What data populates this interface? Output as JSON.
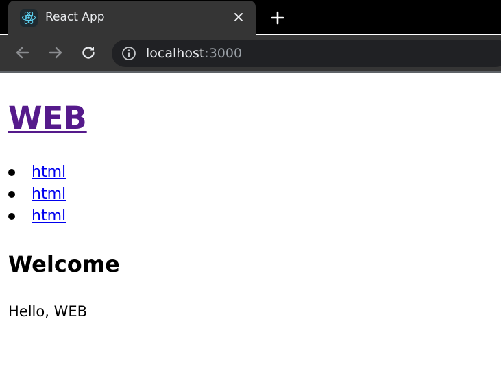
{
  "browser": {
    "tab": {
      "title": "React App",
      "favicon": "react-logo-icon",
      "close_icon": "close-icon"
    },
    "new_tab_icon": "plus-icon",
    "toolbar": {
      "back_icon": "arrow-left-icon",
      "forward_icon": "arrow-right-icon",
      "reload_icon": "reload-icon",
      "info_icon": "info-icon"
    },
    "address": {
      "host": "localhost",
      "port": ":3000"
    },
    "colors": {
      "tabstrip": "#000000",
      "toolbar": "#353535",
      "omnibox": "#202124",
      "react_accent": "#61dafb"
    }
  },
  "page": {
    "title": "WEB",
    "nav": {
      "items": [
        {
          "label": "html"
        },
        {
          "label": "html"
        },
        {
          "label": "html"
        }
      ]
    },
    "article": {
      "title": "Welcome",
      "body": "Hello, WEB"
    },
    "colors": {
      "visited_link": "#551a8b",
      "link": "#0000ee"
    }
  }
}
